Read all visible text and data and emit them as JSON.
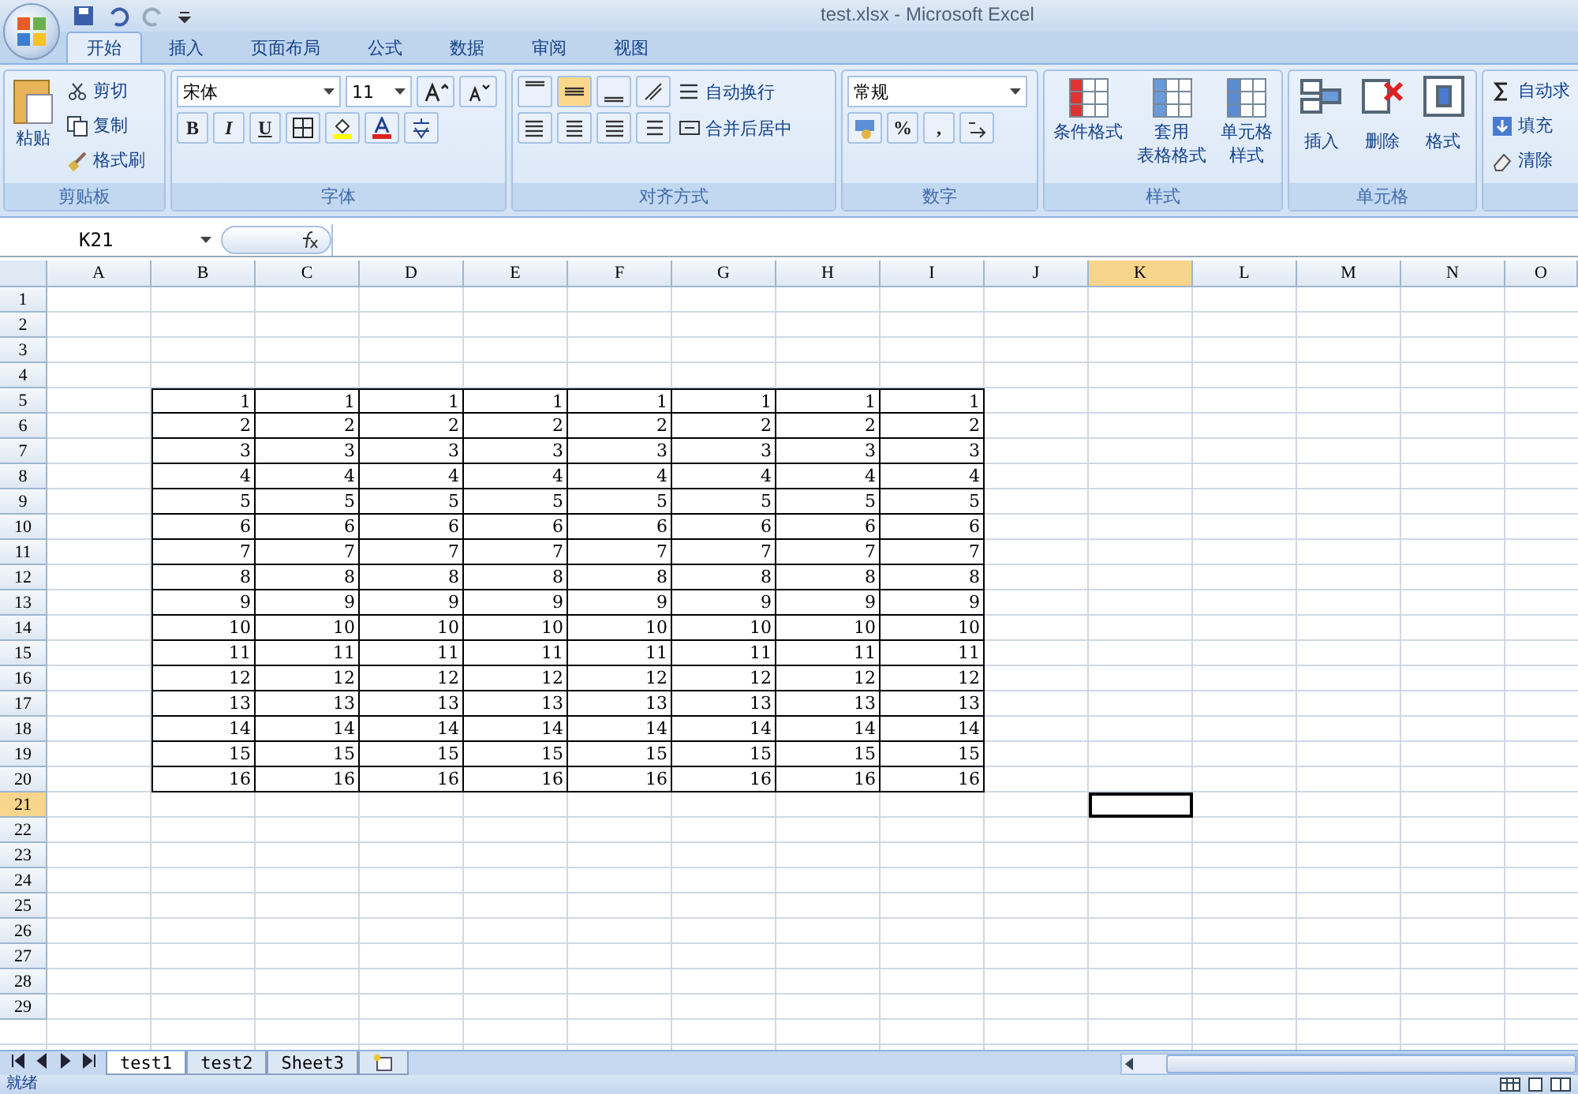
{
  "window": {
    "title": "test.xlsx - Microsoft Excel"
  },
  "tabs": [
    {
      "label": "开始",
      "selected": true
    },
    {
      "label": "插入",
      "selected": false
    },
    {
      "label": "页面布局",
      "selected": false
    },
    {
      "label": "公式",
      "selected": false
    },
    {
      "label": "数据",
      "selected": false
    },
    {
      "label": "审阅",
      "selected": false
    },
    {
      "label": "视图",
      "selected": false
    }
  ],
  "ribbon": {
    "clipboard": {
      "title": "剪贴板",
      "paste": "粘贴",
      "items": [
        "剪切",
        "复制",
        "格式刷"
      ]
    },
    "font": {
      "title": "字体",
      "font_name": "宋体",
      "font_size": "11",
      "styles": [
        "B",
        "I",
        "U"
      ]
    },
    "alignment": {
      "title": "对齐方式",
      "vertical": [
        {
          "selected": false
        },
        {
          "selected": true
        },
        {
          "selected": false
        }
      ],
      "wrap": "自动换行",
      "merge": "合并后居中"
    },
    "number": {
      "title": "数字",
      "format": "常规",
      "symbols": [
        "%",
        ","
      ]
    },
    "styles": {
      "title": "样式",
      "buttons": [
        {
          "lines": [
            "条件格式"
          ]
        },
        {
          "lines": [
            "套用",
            "表格格式"
          ]
        },
        {
          "lines": [
            "单元格",
            "样式"
          ]
        }
      ]
    },
    "cells": {
      "title": "单元格",
      "buttons": [
        "插入",
        "删除",
        "格式"
      ]
    },
    "editing": {
      "items": [
        "自动求",
        "填充",
        "清除"
      ]
    }
  },
  "name_box": "K21",
  "grid": {
    "columns": [
      {
        "label": "A",
        "selected": false
      },
      {
        "label": "B",
        "selected": false
      },
      {
        "label": "C",
        "selected": false
      },
      {
        "label": "D",
        "selected": false
      },
      {
        "label": "E",
        "selected": false
      },
      {
        "label": "F",
        "selected": false
      },
      {
        "label": "G",
        "selected": false
      },
      {
        "label": "H",
        "selected": false
      },
      {
        "label": "I",
        "selected": false
      },
      {
        "label": "J",
        "selected": false
      },
      {
        "label": "K",
        "selected": true
      },
      {
        "label": "L",
        "selected": false
      },
      {
        "label": "M",
        "selected": false
      },
      {
        "label": "N",
        "selected": false
      },
      {
        "label": "O",
        "selected": false
      }
    ],
    "rows": [
      {
        "label": "1",
        "selected": false
      },
      {
        "label": "2",
        "selected": false
      },
      {
        "label": "3",
        "selected": false
      },
      {
        "label": "4",
        "selected": false
      },
      {
        "label": "5",
        "selected": false,
        "values": [
          "1",
          "1",
          "1",
          "1",
          "1",
          "1",
          "1",
          "1"
        ]
      },
      {
        "label": "6",
        "selected": false,
        "values": [
          "2",
          "2",
          "2",
          "2",
          "2",
          "2",
          "2",
          "2"
        ]
      },
      {
        "label": "7",
        "selected": false,
        "values": [
          "3",
          "3",
          "3",
          "3",
          "3",
          "3",
          "3",
          "3"
        ]
      },
      {
        "label": "8",
        "selected": false,
        "values": [
          "4",
          "4",
          "4",
          "4",
          "4",
          "4",
          "4",
          "4"
        ]
      },
      {
        "label": "9",
        "selected": false,
        "values": [
          "5",
          "5",
          "5",
          "5",
          "5",
          "5",
          "5",
          "5"
        ]
      },
      {
        "label": "10",
        "selected": false,
        "values": [
          "6",
          "6",
          "6",
          "6",
          "6",
          "6",
          "6",
          "6"
        ]
      },
      {
        "label": "11",
        "selected": false,
        "values": [
          "7",
          "7",
          "7",
          "7",
          "7",
          "7",
          "7",
          "7"
        ]
      },
      {
        "label": "12",
        "selected": false,
        "values": [
          "8",
          "8",
          "8",
          "8",
          "8",
          "8",
          "8",
          "8"
        ]
      },
      {
        "label": "13",
        "selected": false,
        "values": [
          "9",
          "9",
          "9",
          "9",
          "9",
          "9",
          "9",
          "9"
        ]
      },
      {
        "label": "14",
        "selected": false,
        "values": [
          "10",
          "10",
          "10",
          "10",
          "10",
          "10",
          "10",
          "10"
        ]
      },
      {
        "label": "15",
        "selected": false,
        "values": [
          "11",
          "11",
          "11",
          "11",
          "11",
          "11",
          "11",
          "11"
        ]
      },
      {
        "label": "16",
        "selected": false,
        "values": [
          "12",
          "12",
          "12",
          "12",
          "12",
          "12",
          "12",
          "12"
        ]
      },
      {
        "label": "17",
        "selected": false,
        "values": [
          "13",
          "13",
          "13",
          "13",
          "13",
          "13",
          "13",
          "13"
        ]
      },
      {
        "label": "18",
        "selected": false,
        "values": [
          "14",
          "14",
          "14",
          "14",
          "14",
          "14",
          "14",
          "14"
        ]
      },
      {
        "label": "19",
        "selected": false,
        "values": [
          "15",
          "15",
          "15",
          "15",
          "15",
          "15",
          "15",
          "15"
        ]
      },
      {
        "label": "20",
        "selected": false,
        "values": [
          "16",
          "16",
          "16",
          "16",
          "16",
          "16",
          "16",
          "16"
        ]
      },
      {
        "label": "21",
        "selected": true
      },
      {
        "label": "22",
        "selected": false
      },
      {
        "label": "23",
        "selected": false
      },
      {
        "label": "24",
        "selected": false
      },
      {
        "label": "25",
        "selected": false
      },
      {
        "label": "26",
        "selected": false
      },
      {
        "label": "27",
        "selected": false
      },
      {
        "label": "28",
        "selected": false
      },
      {
        "label": "29",
        "selected": false
      }
    ]
  },
  "sheets": [
    {
      "label": "test1",
      "selected": true
    },
    {
      "label": "test2",
      "selected": false
    },
    {
      "label": "Sheet3",
      "selected": false
    }
  ],
  "status_bar": {
    "text": "就绪"
  }
}
